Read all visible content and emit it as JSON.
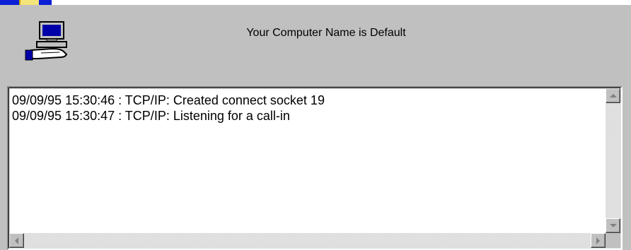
{
  "app": {
    "computer_name_label": "Your Computer Name is Default",
    "icons": {
      "corner": "folder-icon",
      "header": "computer-hand-icon"
    }
  },
  "log": {
    "lines": [
      "09/09/95 15:30:46 : TCP/IP: Created connect socket 19",
      "09/09/95 15:30:47 : TCP/IP: Listening for a call-in"
    ]
  },
  "colors": {
    "window_bg": "#c0c0c0",
    "log_bg": "#ffffff",
    "corner_blue": "#0a1fd6"
  }
}
